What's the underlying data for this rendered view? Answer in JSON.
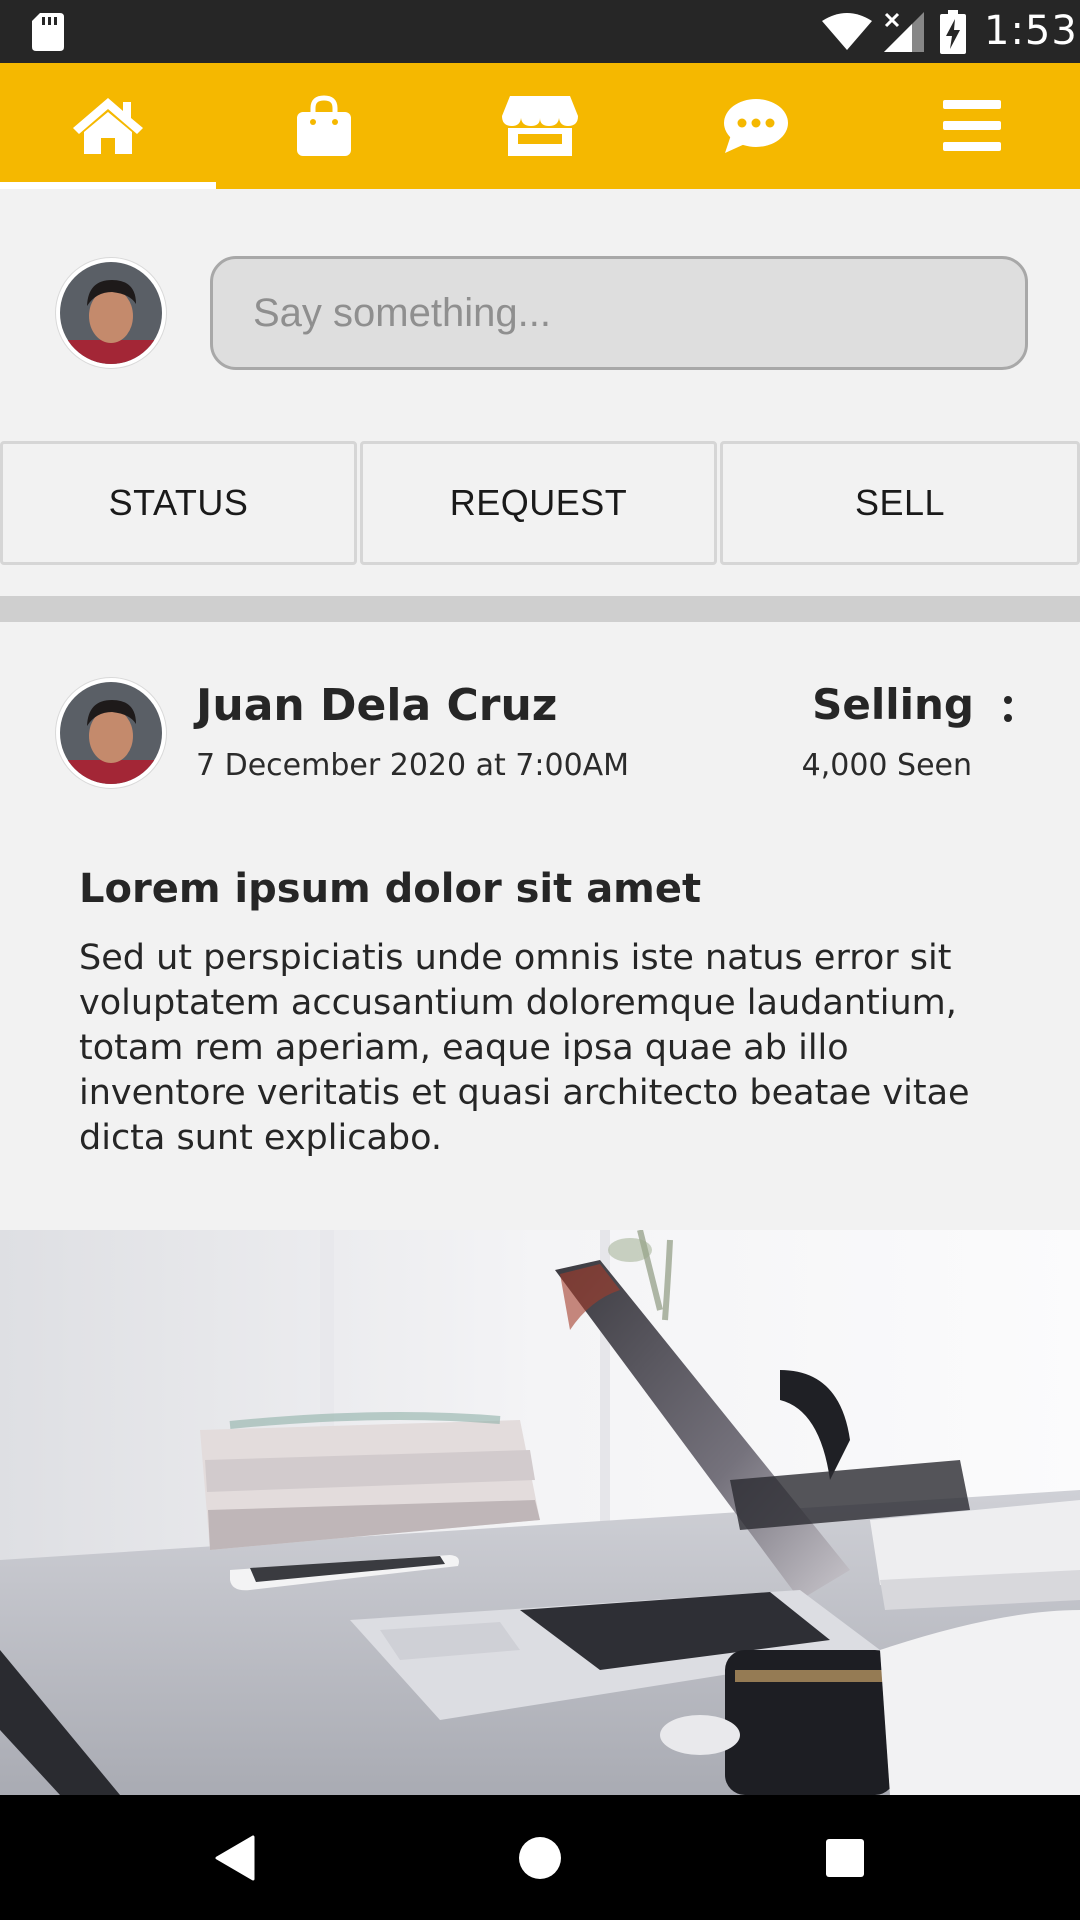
{
  "status_bar": {
    "time": "1:53",
    "icons": [
      "sd-card-icon",
      "wifi-icon",
      "signal-icon",
      "battery-charging-icon"
    ]
  },
  "top_nav": {
    "items": [
      {
        "name": "home",
        "icon": "home-icon",
        "active": true
      },
      {
        "name": "shop",
        "icon": "shopping-bag-icon",
        "active": false
      },
      {
        "name": "store",
        "icon": "store-icon",
        "active": false
      },
      {
        "name": "messages",
        "icon": "chat-icon",
        "active": false
      },
      {
        "name": "menu",
        "icon": "menu-icon",
        "active": false
      }
    ],
    "accent": "#f5b800"
  },
  "composer": {
    "placeholder": "Say something...",
    "value": ""
  },
  "actions": {
    "status_label": "STATUS",
    "request_label": "REQUEST",
    "sell_label": "SELL"
  },
  "post": {
    "author": "Juan Dela Cruz",
    "date": "7 December 2020 at 7:00AM",
    "type": "Selling",
    "views": "4,000 Seen",
    "title": "Lorem ipsum dolor sit amet",
    "body": "Sed ut perspiciatis unde omnis iste natus error sit voluptatem accusantium doloremque laudantium, totam rem aperiam, eaque ipsa quae ab illo inventore veritatis et quasi architecto beatae vitae dicta sunt explicabo."
  },
  "system_nav": {
    "icons": [
      "back-icon",
      "home-circle-icon",
      "recents-icon"
    ]
  }
}
